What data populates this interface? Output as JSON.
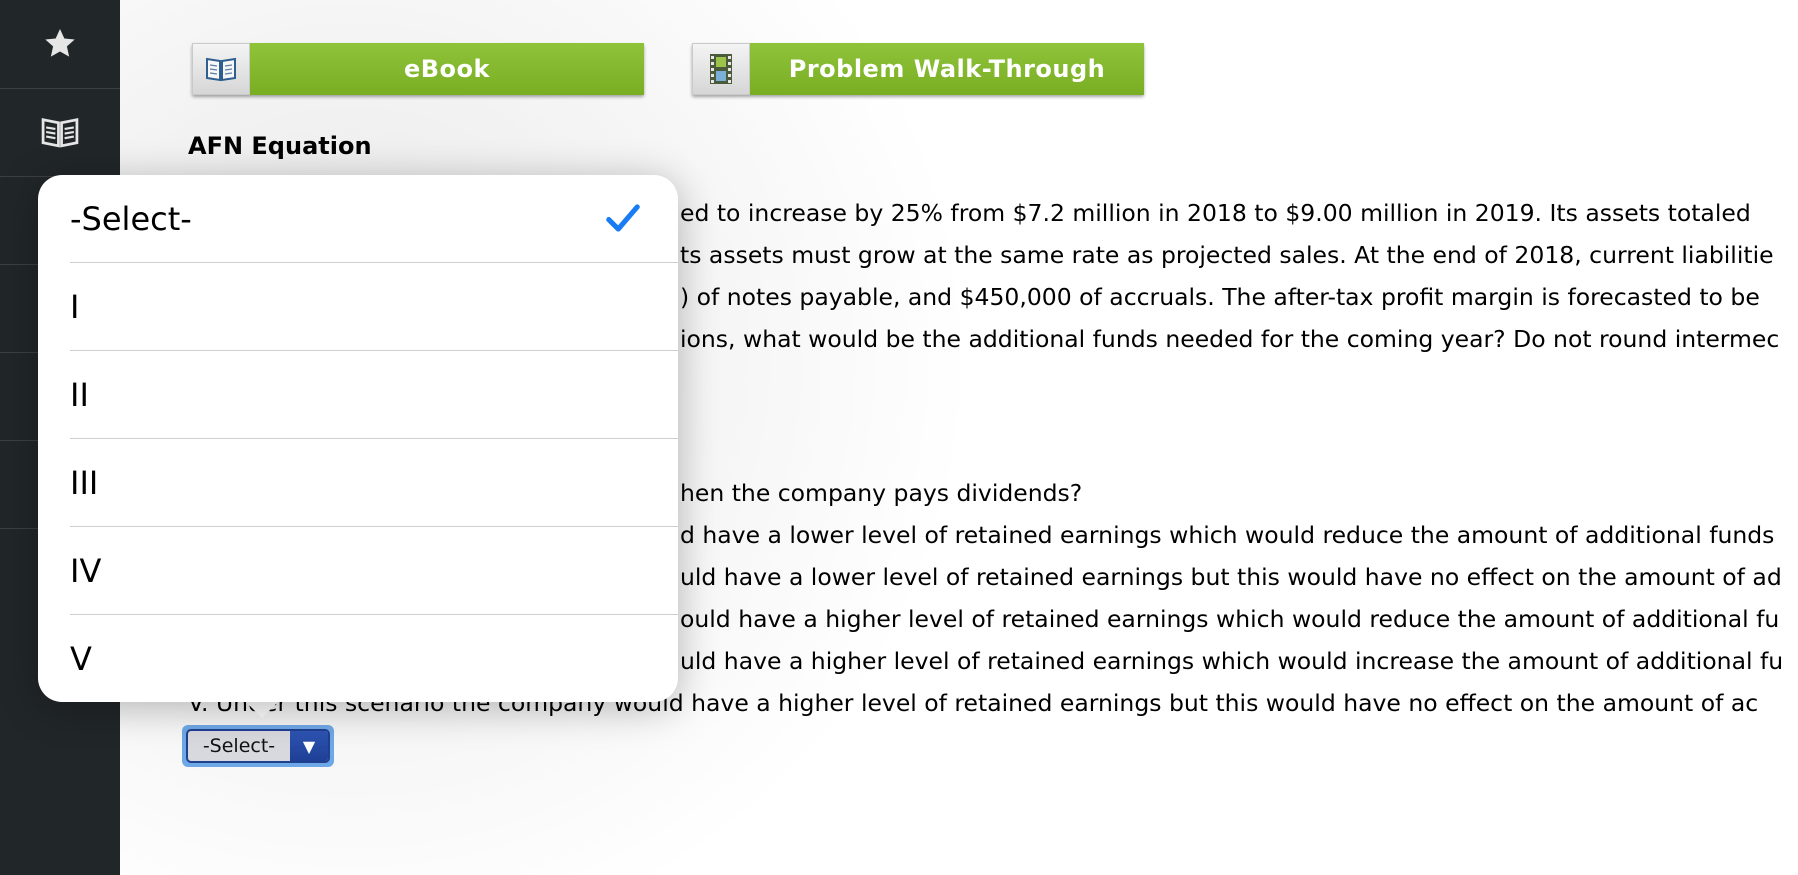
{
  "sidebar": {
    "items": [
      {
        "icon": "star-icon"
      },
      {
        "icon": "book-open-icon"
      },
      {
        "icon": "unknown-icon"
      },
      {
        "icon": "unknown-icon"
      },
      {
        "icon": "unknown-icon"
      },
      {
        "icon": "unknown-icon"
      }
    ]
  },
  "toolbar": {
    "ebook_label": "eBook",
    "ebook_icon": "book-icon",
    "walkthrough_label": "Problem Walk-Through",
    "walkthrough_icon": "film-icon",
    "accent_color": "#86bb2f"
  },
  "problem": {
    "title": "AFN Equation",
    "lines": [
      "ed to increase by 25% from $7.2 million in 2018 to $9.00 million in 2019. Its assets totaled",
      "ts assets must grow at the same rate as projected sales. At the end of 2018, current liabilitie",
      ") of notes payable, and $450,000 of accruals. The after-tax profit margin is forecasted to be",
      "ions, what would be the additional funds needed for the coming year? Do not round intermec"
    ],
    "question": "hen the company pays dividends?",
    "choices": [
      "d have a lower level of retained earnings which would reduce the amount of additional funds",
      "uld have a lower level of retained earnings but this would have no effect on the amount of ad",
      "ould have a higher level of retained earnings which would reduce the amount of additional fu",
      "uld have a higher level of retained earnings which would increase the amount of additional fu",
      "V. Under this scenario the company would have a higher level of retained earnings but this would have no effect on the amount of ac"
    ]
  },
  "select": {
    "value": "-Select-"
  },
  "dropdown": {
    "options": [
      "-Select-",
      "I",
      "II",
      "III",
      "IV",
      "V"
    ],
    "selected_index": 0,
    "check_color": "#1a7cf5"
  }
}
